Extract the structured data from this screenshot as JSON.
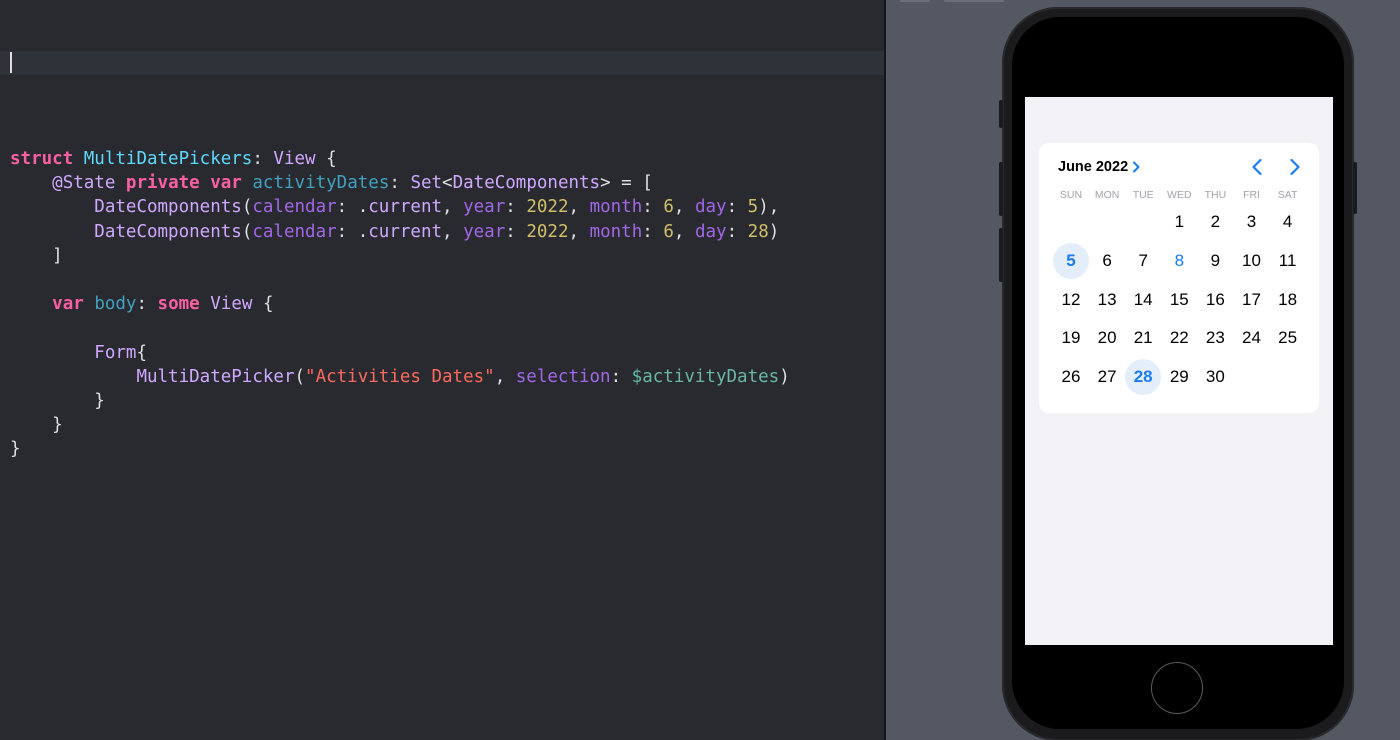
{
  "editor": {
    "code_lines": [
      [
        {
          "t": "struct",
          "c": "kw"
        },
        {
          "t": " "
        },
        {
          "t": "MultiDatePickers",
          "c": "decl"
        },
        {
          "t": ": "
        },
        {
          "t": "View",
          "c": "type"
        },
        {
          "t": " {"
        }
      ],
      [
        {
          "t": "    "
        },
        {
          "t": "@State",
          "c": "type"
        },
        {
          "t": " "
        },
        {
          "t": "private",
          "c": "kw"
        },
        {
          "t": " "
        },
        {
          "t": "var",
          "c": "kw"
        },
        {
          "t": " "
        },
        {
          "t": "activityDates",
          "c": "prop"
        },
        {
          "t": ": "
        },
        {
          "t": "Set",
          "c": "type"
        },
        {
          "t": "<"
        },
        {
          "t": "DateComponents",
          "c": "type"
        },
        {
          "t": "> = ["
        }
      ],
      [
        {
          "t": "        "
        },
        {
          "t": "DateComponents",
          "c": "type"
        },
        {
          "t": "("
        },
        {
          "t": "calendar",
          "c": "lab"
        },
        {
          "t": ": ."
        },
        {
          "t": "current",
          "c": "mem"
        },
        {
          "t": ", "
        },
        {
          "t": "year",
          "c": "lab"
        },
        {
          "t": ": "
        },
        {
          "t": "2022",
          "c": "num"
        },
        {
          "t": ", "
        },
        {
          "t": "month",
          "c": "lab"
        },
        {
          "t": ": "
        },
        {
          "t": "6",
          "c": "num"
        },
        {
          "t": ", "
        },
        {
          "t": "day",
          "c": "lab"
        },
        {
          "t": ": "
        },
        {
          "t": "5",
          "c": "num"
        },
        {
          "t": "),"
        }
      ],
      [
        {
          "t": "        "
        },
        {
          "t": "DateComponents",
          "c": "type"
        },
        {
          "t": "("
        },
        {
          "t": "calendar",
          "c": "lab"
        },
        {
          "t": ": ."
        },
        {
          "t": "current",
          "c": "mem"
        },
        {
          "t": ", "
        },
        {
          "t": "year",
          "c": "lab"
        },
        {
          "t": ": "
        },
        {
          "t": "2022",
          "c": "num"
        },
        {
          "t": ", "
        },
        {
          "t": "month",
          "c": "lab"
        },
        {
          "t": ": "
        },
        {
          "t": "6",
          "c": "num"
        },
        {
          "t": ", "
        },
        {
          "t": "day",
          "c": "lab"
        },
        {
          "t": ": "
        },
        {
          "t": "28",
          "c": "num"
        },
        {
          "t": ")"
        }
      ],
      [
        {
          "t": "    ]"
        }
      ],
      [
        {
          "t": ""
        }
      ],
      [
        {
          "t": "    "
        },
        {
          "t": "var",
          "c": "kw"
        },
        {
          "t": " "
        },
        {
          "t": "body",
          "c": "prop"
        },
        {
          "t": ": "
        },
        {
          "t": "some",
          "c": "kw"
        },
        {
          "t": " "
        },
        {
          "t": "View",
          "c": "type"
        },
        {
          "t": " {"
        }
      ],
      [
        {
          "t": ""
        }
      ],
      [
        {
          "t": "        "
        },
        {
          "t": "Form",
          "c": "type"
        },
        {
          "t": "{"
        }
      ],
      [
        {
          "t": "            "
        },
        {
          "t": "MultiDatePicker",
          "c": "type"
        },
        {
          "t": "("
        },
        {
          "t": "\"Activities Dates\"",
          "c": "str"
        },
        {
          "t": ", "
        },
        {
          "t": "selection",
          "c": "lab"
        },
        {
          "t": ": "
        },
        {
          "t": "$activityDates",
          "c": "var"
        },
        {
          "t": ")"
        }
      ],
      [
        {
          "t": "        }"
        }
      ],
      [
        {
          "t": "    }"
        }
      ],
      [
        {
          "t": "}"
        }
      ]
    ]
  },
  "preview": {
    "device": "iPhone",
    "date_picker": {
      "month_label": "June 2022",
      "weekdays": [
        "SUN",
        "MON",
        "TUE",
        "WED",
        "THU",
        "FRI",
        "SAT"
      ],
      "first_weekday_index": 3,
      "days_in_month": 30,
      "selected_days": [
        5,
        28
      ],
      "today": 8,
      "icons": {
        "month_disclosure": "chevron-right-icon",
        "previous": "chevron-left-icon",
        "next": "chevron-right-icon"
      }
    }
  },
  "colors": {
    "editor_background": "#292a30",
    "preview_background": "#545863",
    "accent": "#1a7cf0",
    "selection_fill": "#e4eefb"
  }
}
